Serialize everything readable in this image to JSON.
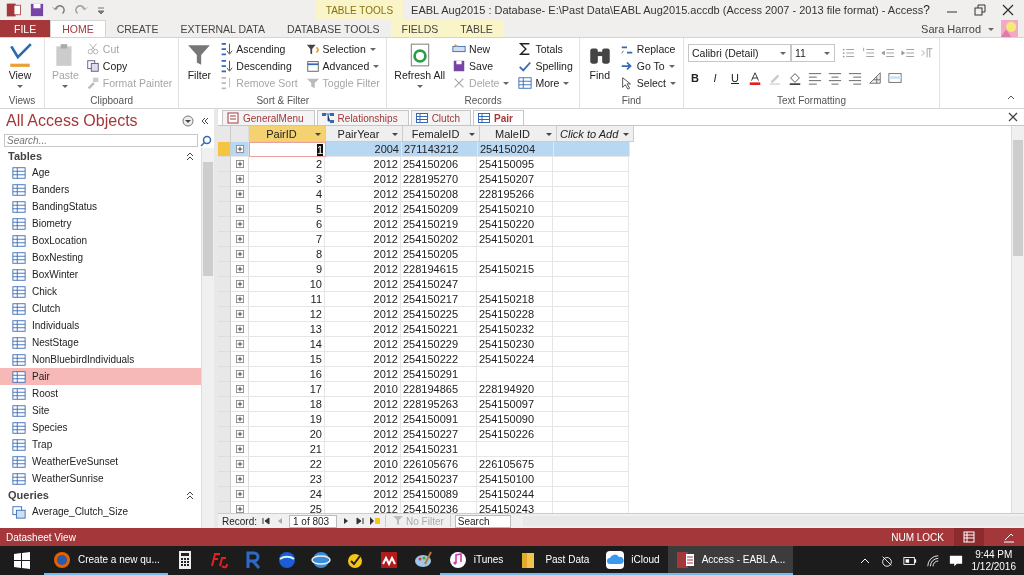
{
  "title_bar": {
    "title": "EABL Aug2015 : Database- E:\\Past Data\\EABL Aug2015.accdb (Access 2007 - 2013 file format) - Access",
    "help": "?",
    "user": "Sara Harrod"
  },
  "context_label": "TABLE TOOLS",
  "ribbon_tabs": [
    {
      "label": "FILE",
      "kind": "file",
      "selected": false
    },
    {
      "label": "HOME",
      "kind": "tab",
      "selected": true
    },
    {
      "label": "CREATE",
      "kind": "tab",
      "selected": false
    },
    {
      "label": "EXTERNAL DATA",
      "kind": "tab",
      "selected": false
    },
    {
      "label": "DATABASE TOOLS",
      "kind": "tab",
      "selected": false
    },
    {
      "label": "FIELDS",
      "kind": "context",
      "selected": false
    },
    {
      "label": "TABLE",
      "kind": "context",
      "selected": false
    }
  ],
  "ribbon_groups": [
    {
      "label": "Views",
      "kind": "buttons",
      "items": [
        {
          "label": "View",
          "kind": "large",
          "disabled": false,
          "menu": true
        }
      ]
    },
    {
      "label": "Clipboard",
      "kind": "buttons",
      "items": [
        {
          "label": "Paste",
          "kind": "large",
          "disabled": true,
          "menu": true
        },
        {
          "label": "Cut",
          "kind": "small",
          "disabled": true,
          "menu": false
        },
        {
          "label": "Copy",
          "kind": "small",
          "disabled": false,
          "menu": false
        },
        {
          "label": "Format Painter",
          "kind": "small",
          "disabled": true,
          "menu": false
        }
      ]
    },
    {
      "label": "Sort & Filter",
      "kind": "buttons",
      "items": [
        {
          "label": "Filter",
          "kind": "large",
          "disabled": false,
          "menu": false
        },
        {
          "label": "Ascending",
          "kind": "small",
          "disabled": false,
          "menu": false
        },
        {
          "label": "Descending",
          "kind": "small",
          "disabled": false,
          "menu": false
        },
        {
          "label": "Remove Sort",
          "kind": "small",
          "disabled": true,
          "menu": false
        },
        {
          "label": "Selection",
          "kind": "small",
          "disabled": false,
          "menu": true
        },
        {
          "label": "Advanced",
          "kind": "small",
          "disabled": false,
          "menu": true
        },
        {
          "label": "Toggle Filter",
          "kind": "small",
          "disabled": true,
          "menu": false
        }
      ]
    },
    {
      "label": "Records",
      "kind": "buttons",
      "items": [
        {
          "label": "Refresh All",
          "kind": "large",
          "disabled": false,
          "menu": true
        },
        {
          "label": "New",
          "kind": "small",
          "disabled": false,
          "menu": false
        },
        {
          "label": "Save",
          "kind": "small",
          "disabled": false,
          "menu": false
        },
        {
          "label": "Delete",
          "kind": "small",
          "disabled": true,
          "menu": true
        },
        {
          "label": "Totals",
          "kind": "small",
          "disabled": false,
          "menu": false
        },
        {
          "label": "Spelling",
          "kind": "small",
          "disabled": false,
          "menu": false
        },
        {
          "label": "More",
          "kind": "small",
          "disabled": false,
          "menu": true
        }
      ]
    },
    {
      "label": "Find",
      "kind": "buttons",
      "items": [
        {
          "label": "Find",
          "kind": "large",
          "disabled": false,
          "menu": false
        },
        {
          "label": "Replace",
          "kind": "small",
          "disabled": false,
          "menu": false
        },
        {
          "label": "Go To",
          "kind": "small",
          "disabled": false,
          "menu": true
        },
        {
          "label": "Select",
          "kind": "small",
          "disabled": false,
          "menu": true
        }
      ]
    },
    {
      "label": "Text Formatting",
      "kind": "formatting",
      "font": "Calibri (Detail)",
      "size": "11",
      "styles": [
        "B",
        "I",
        "U"
      ]
    }
  ],
  "navigation": {
    "title": "All Access Objects",
    "search_placeholder": "Search...",
    "groups": [
      {
        "label": "Tables",
        "items": [
          {
            "label": "Age",
            "selected": false
          },
          {
            "label": "Banders",
            "selected": false
          },
          {
            "label": "BandingStatus",
            "selected": false
          },
          {
            "label": "Biometry",
            "selected": false
          },
          {
            "label": "BoxLocation",
            "selected": false
          },
          {
            "label": "BoxNesting",
            "selected": false
          },
          {
            "label": "BoxWinter",
            "selected": false
          },
          {
            "label": "Chick",
            "selected": false
          },
          {
            "label": "Clutch",
            "selected": false
          },
          {
            "label": "Individuals",
            "selected": false
          },
          {
            "label": "NestStage",
            "selected": false
          },
          {
            "label": "NonBluebirdIndividuals",
            "selected": false
          },
          {
            "label": "Pair",
            "selected": true
          },
          {
            "label": "Roost",
            "selected": false
          },
          {
            "label": "Site",
            "selected": false
          },
          {
            "label": "Species",
            "selected": false
          },
          {
            "label": "Trap",
            "selected": false
          },
          {
            "label": "WeatherEveSunset",
            "selected": false
          },
          {
            "label": "WeatherSunrise",
            "selected": false
          }
        ]
      },
      {
        "label": "Queries",
        "items": [
          {
            "label": "Average_Clutch_Size",
            "selected": false
          }
        ]
      }
    ]
  },
  "document_tabs": [
    {
      "label": "GeneralMenu",
      "kind": "form",
      "selected": false
    },
    {
      "label": "Relationships",
      "kind": "relationships",
      "selected": false
    },
    {
      "label": "Clutch",
      "kind": "table",
      "selected": false
    },
    {
      "label": "Pair",
      "kind": "table",
      "selected": true
    }
  ],
  "table": {
    "columns": [
      {
        "label": "PairID",
        "kind": "field",
        "selected": true
      },
      {
        "label": "PairYear",
        "kind": "field",
        "selected": false
      },
      {
        "label": "FemaleID",
        "kind": "field",
        "selected": false
      },
      {
        "label": "MaleID",
        "kind": "field",
        "selected": false
      },
      {
        "label": "Click to Add",
        "kind": "add",
        "selected": false
      }
    ],
    "rows": [
      {
        "selected": true,
        "cells": [
          "1",
          "2004",
          "271143212",
          "254150204"
        ]
      },
      {
        "selected": false,
        "cells": [
          "2",
          "2012",
          "254150206",
          "254150095"
        ]
      },
      {
        "selected": false,
        "cells": [
          "3",
          "2012",
          "228195270",
          "254150207"
        ]
      },
      {
        "selected": false,
        "cells": [
          "4",
          "2012",
          "254150208",
          "228195266"
        ]
      },
      {
        "selected": false,
        "cells": [
          "5",
          "2012",
          "254150209",
          "254150210"
        ]
      },
      {
        "selected": false,
        "cells": [
          "6",
          "2012",
          "254150219",
          "254150220"
        ]
      },
      {
        "selected": false,
        "cells": [
          "7",
          "2012",
          "254150202",
          "254150201"
        ]
      },
      {
        "selected": false,
        "cells": [
          "8",
          "2012",
          "254150205"
        ]
      },
      {
        "selected": false,
        "cells": [
          "9",
          "2012",
          "228194615",
          "254150215"
        ]
      },
      {
        "selected": false,
        "cells": [
          "10",
          "2012",
          "254150247"
        ]
      },
      {
        "selected": false,
        "cells": [
          "11",
          "2012",
          "254150217",
          "254150218"
        ]
      },
      {
        "selected": false,
        "cells": [
          "12",
          "2012",
          "254150225",
          "254150228"
        ]
      },
      {
        "selected": false,
        "cells": [
          "13",
          "2012",
          "254150221",
          "254150232"
        ]
      },
      {
        "selected": false,
        "cells": [
          "14",
          "2012",
          "254150229",
          "254150230"
        ]
      },
      {
        "selected": false,
        "cells": [
          "15",
          "2012",
          "254150222",
          "254150224"
        ]
      },
      {
        "selected": false,
        "cells": [
          "16",
          "2012",
          "254150291"
        ]
      },
      {
        "selected": false,
        "cells": [
          "17",
          "2010",
          "228194865",
          "228194920"
        ]
      },
      {
        "selected": false,
        "cells": [
          "18",
          "2012",
          "228195263",
          "254150097"
        ]
      },
      {
        "selected": false,
        "cells": [
          "19",
          "2012",
          "254150091",
          "254150090"
        ]
      },
      {
        "selected": false,
        "cells": [
          "20",
          "2012",
          "254150227",
          "254150226"
        ]
      },
      {
        "selected": false,
        "cells": [
          "21",
          "2012",
          "254150231"
        ]
      },
      {
        "selected": false,
        "cells": [
          "22",
          "2010",
          "226105676",
          "226105675"
        ]
      },
      {
        "selected": false,
        "cells": [
          "23",
          "2012",
          "254150237",
          "254150100"
        ]
      },
      {
        "selected": false,
        "cells": [
          "24",
          "2012",
          "254150089",
          "254150244"
        ]
      },
      {
        "selected": false,
        "cells": [
          "25",
          "2012",
          "254150236",
          "254150243"
        ]
      }
    ]
  },
  "record_navigator": {
    "label": "Record:",
    "position": "1 of 803",
    "filter": "No Filter",
    "filter_disabled": true,
    "search_placeholder": "Search"
  },
  "status_bar": {
    "view": "Datasheet View",
    "indicator": "NUM LOCK"
  },
  "taskbar": {
    "items": [
      {
        "kind": "start",
        "open": false,
        "selected": false
      },
      {
        "kind": "app",
        "label": "Create a new qu...",
        "open": true,
        "selected": false
      },
      {
        "kind": "pin",
        "open": false,
        "selected": false
      },
      {
        "kind": "pin",
        "open": false,
        "selected": false
      },
      {
        "kind": "pin",
        "open": false,
        "selected": false
      },
      {
        "kind": "pin",
        "open": false,
        "selected": false
      },
      {
        "kind": "pin",
        "open": false,
        "selected": false
      },
      {
        "kind": "pin",
        "open": false,
        "selected": false
      },
      {
        "kind": "pin",
        "open": false,
        "selected": false
      },
      {
        "kind": "pin",
        "open": false,
        "selected": false
      },
      {
        "kind": "app",
        "label": "iTunes",
        "open": true,
        "selected": false
      },
      {
        "kind": "app",
        "label": "Past Data",
        "open": true,
        "selected": false
      },
      {
        "kind": "app",
        "label": "iCloud",
        "open": true,
        "selected": false
      },
      {
        "kind": "app",
        "label": "Access - EABL A...",
        "open": true,
        "selected": true
      }
    ],
    "time": "9:44 PM",
    "date": "1/12/2016"
  }
}
